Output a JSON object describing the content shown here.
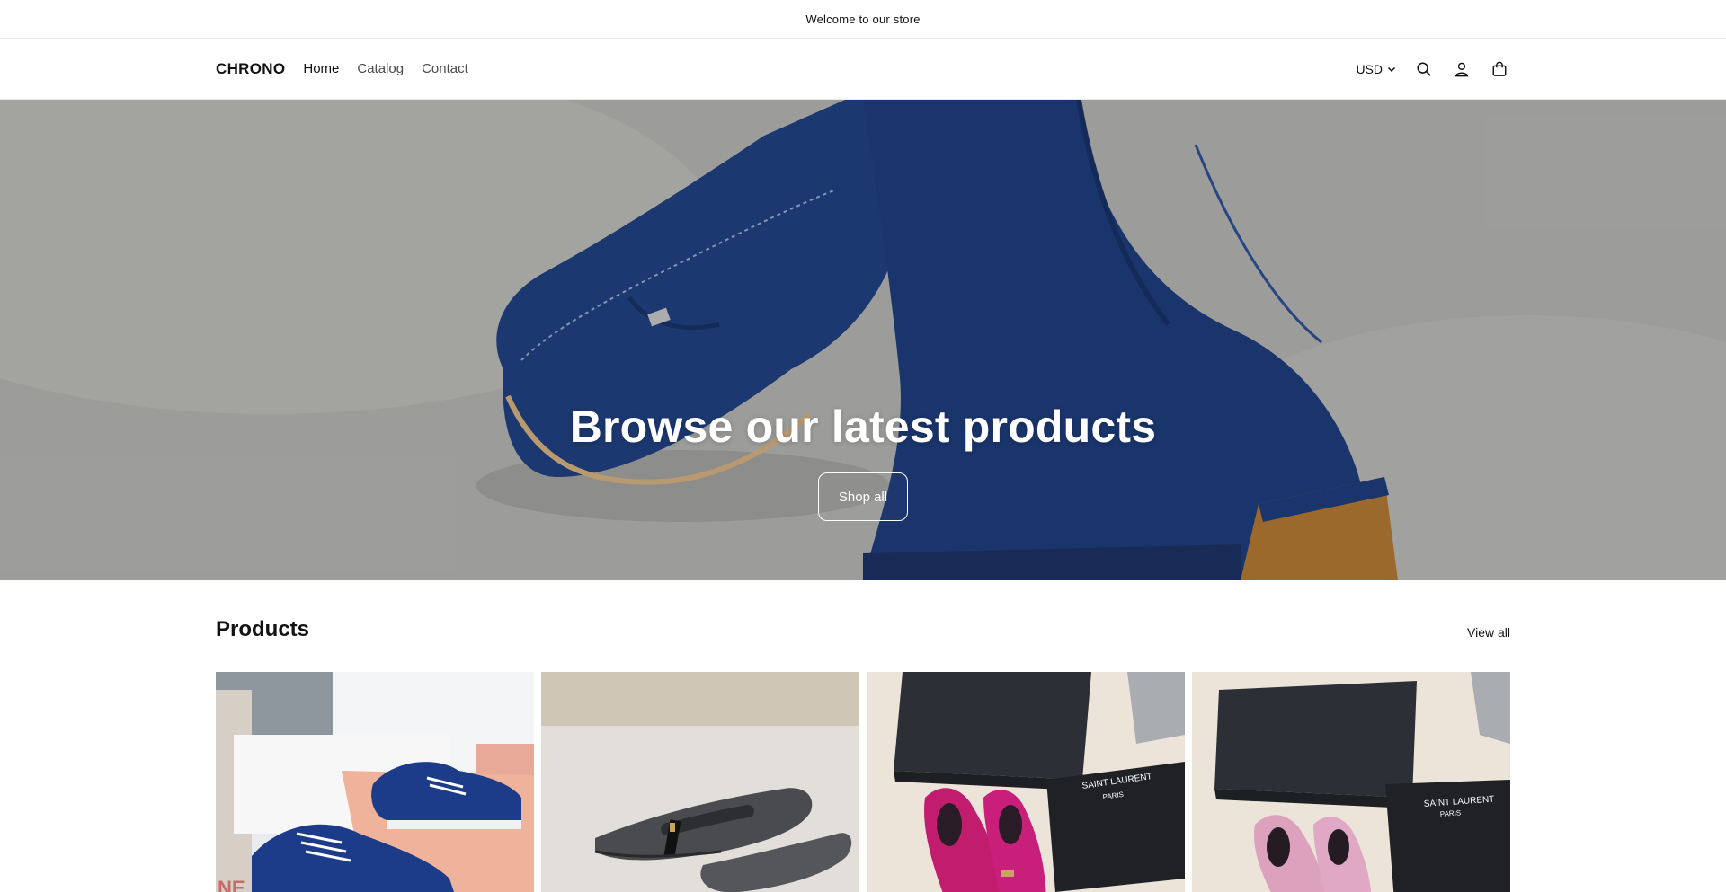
{
  "announcement": {
    "text": "Welcome to our store"
  },
  "header": {
    "logo": "CHRONO",
    "nav": [
      {
        "label": "Home"
      },
      {
        "label": "Catalog"
      },
      {
        "label": "Contact"
      }
    ],
    "currency": "USD",
    "icons": [
      "search-icon",
      "account-icon",
      "cart-icon"
    ]
  },
  "hero": {
    "title": "Browse our latest products",
    "button": "Shop all",
    "image": "blue-suede-shoes"
  },
  "products": {
    "heading": "Products",
    "view_all": "View all",
    "items": [
      {
        "image": "blue-sneakers"
      },
      {
        "image": "black-pointed-flats"
      },
      {
        "image": "magenta-suede-flats",
        "printed_text": [
          "SAINT LAURENT",
          "PARIS"
        ]
      },
      {
        "image": "pink-flats",
        "printed_text": [
          "SAINT LAURENT",
          "PARIS"
        ]
      }
    ]
  },
  "colors": {
    "text": "#121212",
    "border": "#e8e8e8",
    "suede_blue": "#1e3b78"
  }
}
